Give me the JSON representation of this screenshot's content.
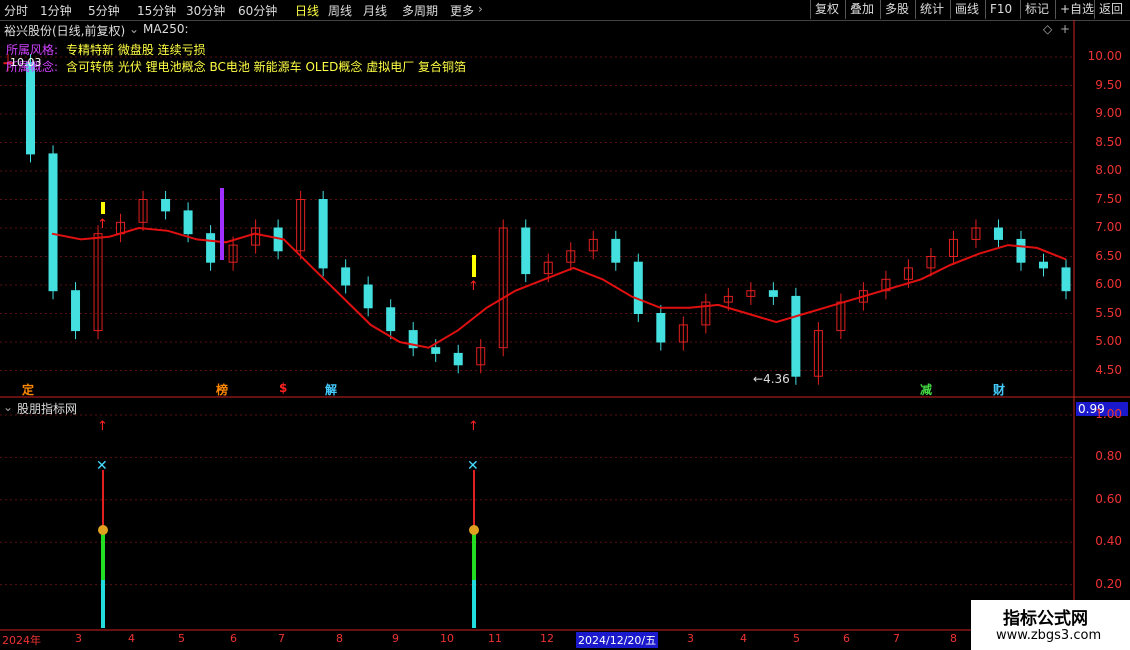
{
  "toolbar": {
    "periods": [
      "分时",
      "1分钟",
      "5分钟",
      "15分钟",
      "30分钟",
      "60分钟",
      "日线",
      "周线",
      "月线",
      "多周期",
      "更多"
    ],
    "active_period": "日线",
    "tools": [
      "复权",
      "叠加",
      "多股",
      "统计",
      "画线",
      "F10",
      "标记",
      "+自选",
      "返回"
    ]
  },
  "title": {
    "stock": "裕兴股份(日线,前复权)",
    "ma": "MA250:"
  },
  "info": {
    "style_label": "所属风格:",
    "style_value": "专精特新 微盘股 连续亏损",
    "concept_label": "所属概念:",
    "concept_value": "含可转债 光伏 锂电池概念 BC电池 新能源车 OLED概念 虚拟电厂 复合铜箔",
    "overlap_value": "10.03"
  },
  "main_axis": [
    "10.00",
    "9.50",
    "9.00",
    "8.50",
    "8.00",
    "7.50",
    "7.00",
    "6.50",
    "6.00",
    "5.50",
    "5.00",
    "4.50"
  ],
  "low_marker": "4.36",
  "events": [
    "定",
    "榜",
    "$",
    "解",
    "减",
    "财"
  ],
  "indicator": {
    "name": "股朋指标网",
    "current_value": "0.99",
    "axis": [
      "1.00",
      "0.80",
      "0.60",
      "0.40",
      "0.20"
    ]
  },
  "x_axis": [
    "2024年",
    "3",
    "4",
    "5",
    "6",
    "7",
    "8",
    "9",
    "10",
    "11",
    "12",
    "2024/12/20/五",
    "3",
    "4",
    "5",
    "6",
    "7",
    "8"
  ],
  "watermark": {
    "line1": "指标公式网",
    "line2": "www.zbgs3.com"
  },
  "chart_data": {
    "type": "line",
    "ylim": [
      4.3,
      10.3
    ],
    "ma250": [
      6.9,
      6.8,
      6.85,
      7.0,
      6.95,
      6.8,
      6.75,
      6.9,
      6.8,
      6.3,
      5.8,
      5.3,
      5.0,
      4.9,
      5.2,
      5.6,
      5.9,
      6.1,
      6.3,
      6.1,
      5.8,
      5.6,
      5.6,
      5.65,
      5.5,
      5.35,
      5.5,
      5.65,
      5.8,
      5.95,
      6.1,
      6.35,
      6.55,
      6.7,
      6.65,
      6.45
    ],
    "close": [
      9.9,
      8.3,
      5.9,
      5.2,
      6.9,
      7.1,
      7.5,
      7.3,
      6.9,
      6.4,
      6.7,
      7.0,
      6.6,
      7.5,
      6.3,
      6.0,
      5.6,
      5.2,
      4.9,
      4.8,
      4.6,
      4.9,
      7.0,
      6.2,
      6.4,
      6.6,
      6.8,
      6.4,
      5.5,
      5.0,
      5.3,
      5.7,
      5.8,
      5.9,
      5.8,
      4.4,
      5.2,
      5.7,
      5.9,
      6.1,
      6.3,
      6.5,
      6.8,
      7.0,
      6.8,
      6.4,
      6.3,
      5.9
    ]
  }
}
